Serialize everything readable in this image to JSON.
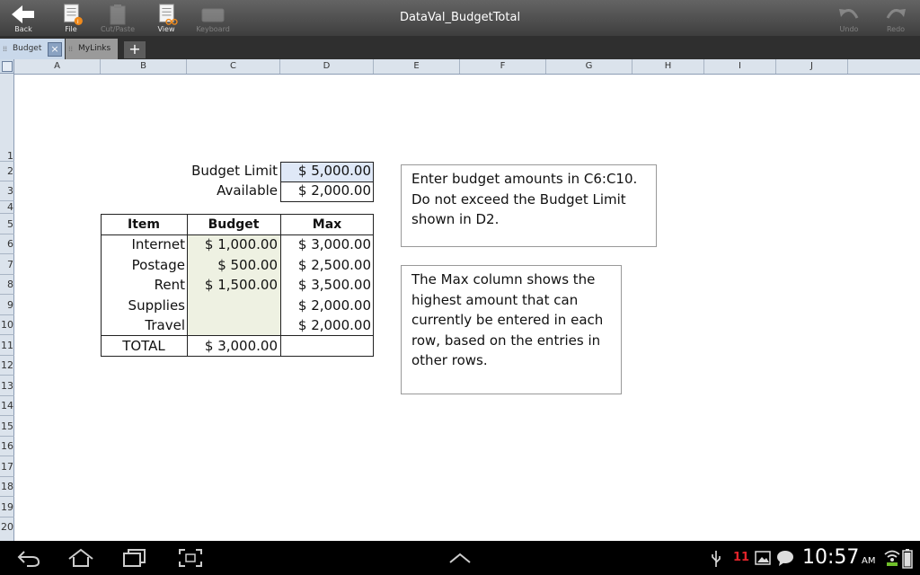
{
  "toolbar": {
    "back_label": "Back",
    "file_label": "File",
    "cutpaste_label": "Cut/Paste",
    "view_label": "View",
    "keyboard_label": "Keyboard",
    "undo_label": "Undo",
    "redo_label": "Redo"
  },
  "window": {
    "title": "DataVal_BudgetTotal"
  },
  "tabs": [
    {
      "label": "Budget",
      "active": true
    },
    {
      "label": "MyLinks",
      "active": false
    }
  ],
  "add_tab_label": "+",
  "columns": [
    "A",
    "B",
    "C",
    "D",
    "E",
    "F",
    "G",
    "H",
    "I",
    "J"
  ],
  "rows": [
    "1",
    "2",
    "3",
    "4",
    "5",
    "6",
    "7",
    "8",
    "9",
    "10",
    "11",
    "12",
    "13",
    "14",
    "15",
    "16",
    "17",
    "18",
    "19",
    "20"
  ],
  "sheet": {
    "budget_limit_label": "Budget Limit",
    "budget_limit_value": "$ 5,000.00",
    "available_label": "Available",
    "available_value": "$ 2,000.00",
    "table": {
      "headers": [
        "Item",
        "Budget",
        "Max"
      ],
      "rows": [
        {
          "item": "Internet",
          "budget": "$ 1,000.00",
          "max": "$ 3,000.00"
        },
        {
          "item": "Postage",
          "budget": "$ 500.00",
          "max": "$ 2,500.00"
        },
        {
          "item": "Rent",
          "budget": "$ 1,500.00",
          "max": "$ 3,500.00"
        },
        {
          "item": "Supplies",
          "budget": "",
          "max": "$ 2,000.00"
        },
        {
          "item": "Travel",
          "budget": "",
          "max": "$ 2,000.00"
        }
      ],
      "total_label": "TOTAL",
      "total_value": "$ 3,000.00"
    },
    "note1": [
      "Enter budget amounts in C6:C10.",
      "Do not exceed the Budget Limit",
      "shown in D2."
    ],
    "note2": [
      "The Max column shows the",
      "highest amount that can",
      "currently be entered in each",
      "row, based on the entries in",
      "other rows."
    ]
  },
  "statusbar": {
    "notification_count": "11",
    "time": "10:57",
    "ampm": "AM"
  },
  "colors": {
    "toolbar": "#4a4a4a",
    "tab_active": "#c9d8ea",
    "budget_fill": "#eef1e2",
    "limit_fill": "#dfe8f7",
    "notification": "#e2242a"
  }
}
